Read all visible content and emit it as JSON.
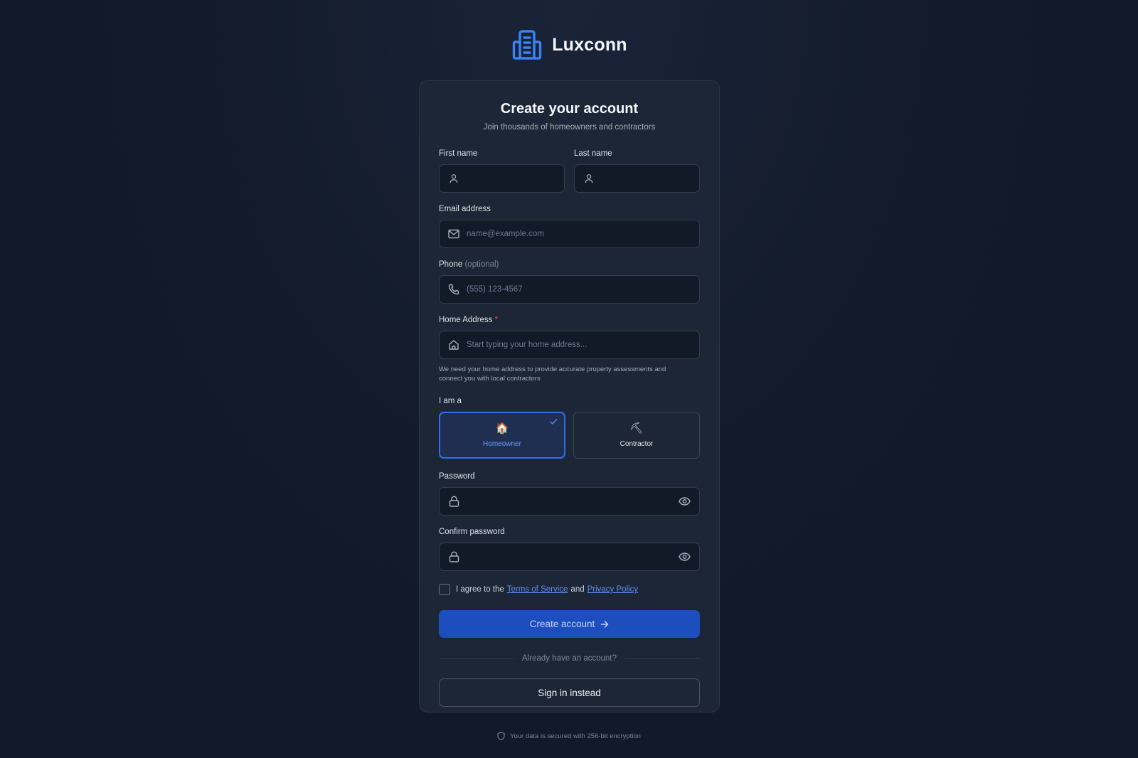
{
  "brand": {
    "name": "Luxconn",
    "logo_icon": "building-icon",
    "accent": "#3b82f6"
  },
  "header": {
    "title": "Create your account",
    "subtitle": "Join thousands of homeowners and contractors"
  },
  "form": {
    "first_name": {
      "label": "First name",
      "value": "",
      "icon": "user-icon"
    },
    "last_name": {
      "label": "Last name",
      "value": "",
      "icon": "user-icon"
    },
    "email": {
      "label": "Email address",
      "placeholder": "name@example.com",
      "icon": "mail-icon"
    },
    "phone": {
      "label": "Phone",
      "label_suffix": "(optional)",
      "placeholder": "(555) 123-4567",
      "icon": "phone-icon"
    },
    "address": {
      "label": "Home Address",
      "required_mark": "*",
      "placeholder": "Start typing your home address...",
      "icon": "home-icon",
      "help": "We need your home address to provide accurate property assessments and connect you with local contractors"
    },
    "role": {
      "label": "I am a",
      "options": [
        {
          "label": "Homeowner",
          "icon": "🏠",
          "selected": true
        },
        {
          "label": "Contractor",
          "icon": "⛏",
          "selected": false
        }
      ]
    },
    "password": {
      "label": "Password",
      "value": "",
      "icon": "lock-icon"
    },
    "confirm_password": {
      "label": "Confirm password",
      "value": "",
      "icon": "lock-icon"
    },
    "agree": {
      "checked": false,
      "prefix": "I agree to the",
      "terms": "Terms of Service",
      "and": "and",
      "privacy": "Privacy Policy"
    }
  },
  "actions": {
    "create": "Create account",
    "divider": "Already have an account?",
    "signin": "Sign in instead"
  },
  "footer": {
    "text": "Your data is secured with 256-bit encryption",
    "icon": "shield-icon"
  }
}
